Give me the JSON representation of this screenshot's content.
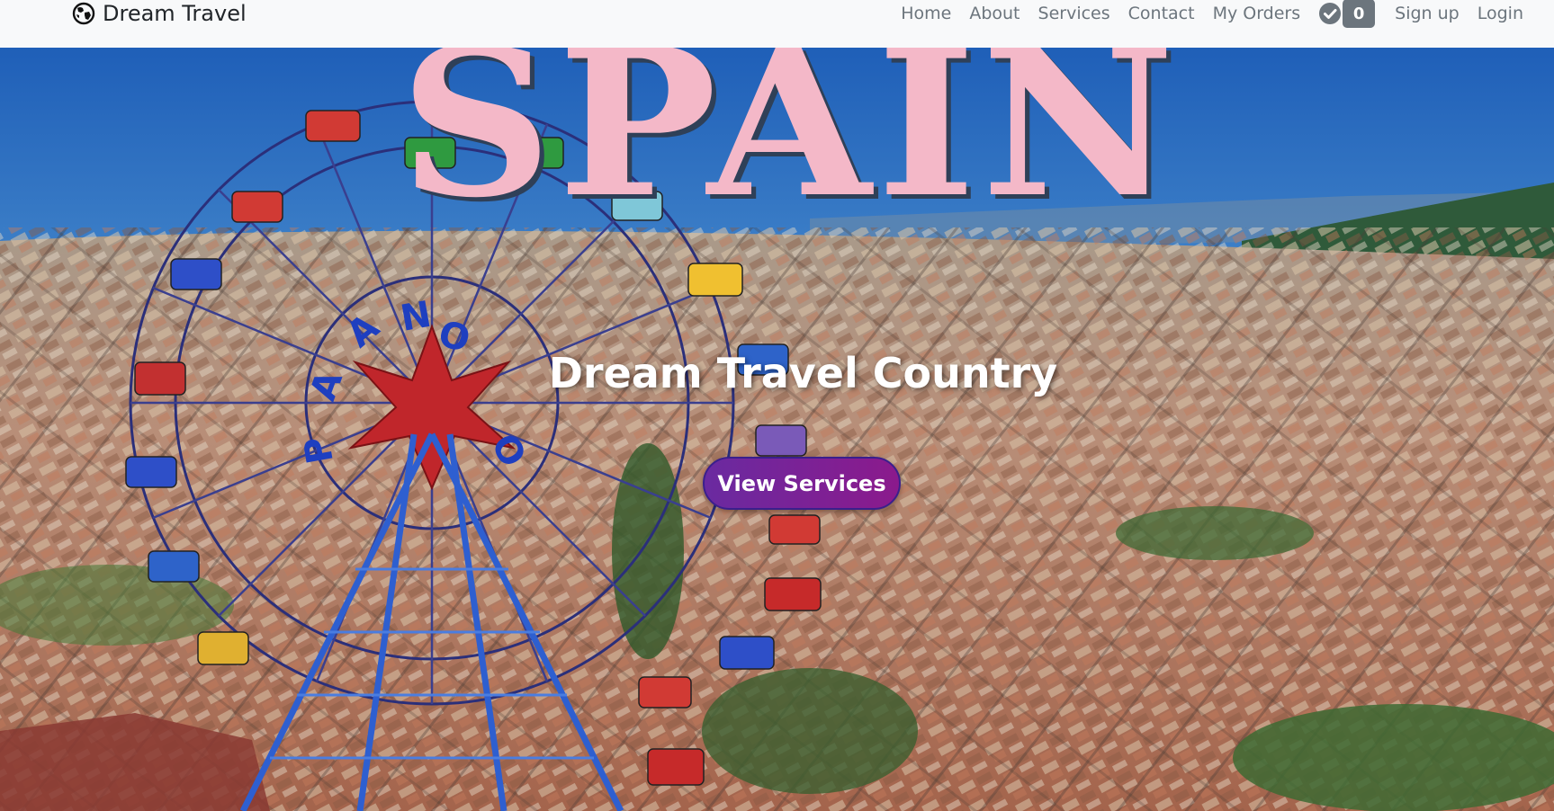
{
  "navbar": {
    "brand": {
      "icon": "globe-icon",
      "label": "Dream Travel"
    },
    "links": [
      {
        "label": "Home"
      },
      {
        "label": "About"
      },
      {
        "label": "Services"
      },
      {
        "label": "Contact"
      },
      {
        "label": "My Orders"
      }
    ],
    "cart": {
      "icon": "check-circle-icon",
      "count": "0"
    },
    "auth": [
      {
        "label": "Sign up"
      },
      {
        "label": "Login"
      }
    ]
  },
  "hero": {
    "heading": "SPAIN",
    "subtitle": "Dream Travel Country",
    "button_label": "View Services",
    "background": "photo-aerial-barcelona-with-ferris-wheel"
  },
  "colors": {
    "navbar_bg": "#f8f9fa",
    "nav_link": "#6c757d",
    "heading_pink": "#f4b8c8",
    "button_purple": "#7a2296",
    "badge_gray": "#6c757d"
  }
}
